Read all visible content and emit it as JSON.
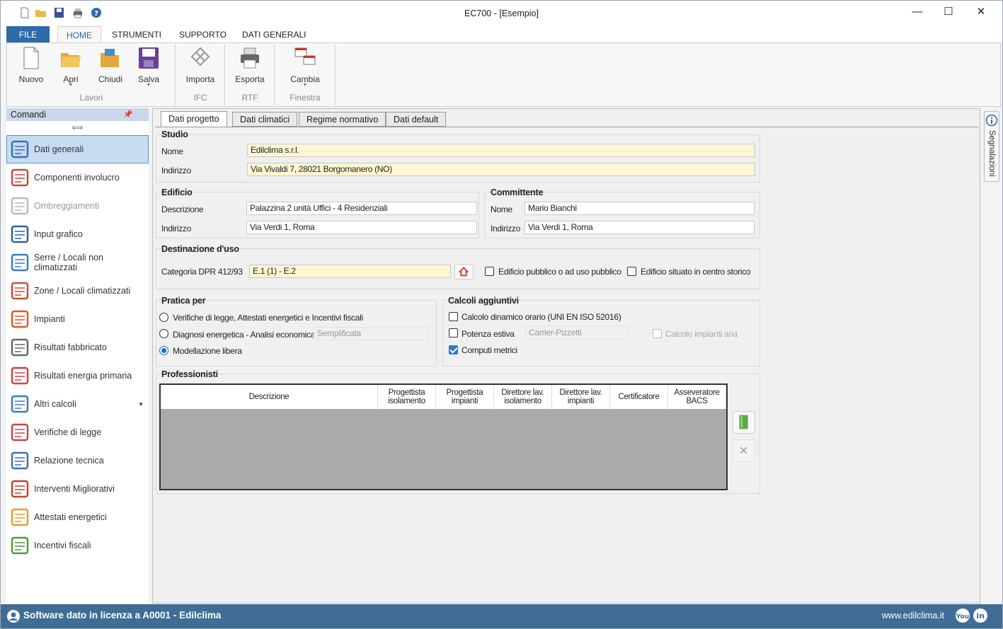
{
  "window": {
    "title": "EC700 - [Esempio]",
    "min": "—",
    "max": "☐",
    "close": "✕"
  },
  "ribbon_tabs": [
    "FILE",
    "HOME",
    "STRUMENTI",
    "SUPPORTO",
    "DATI GENERALI"
  ],
  "ribbon": {
    "buttons": [
      {
        "label": "Nuovo",
        "icon": "new-file-icon"
      },
      {
        "label": "Apri",
        "icon": "open-folder-icon"
      },
      {
        "label": "Chiudi",
        "icon": "close-folder-icon"
      },
      {
        "label": "Salva",
        "icon": "save-icon"
      },
      {
        "label": "Importa",
        "icon": "import-ifc-icon"
      },
      {
        "label": "Esporta",
        "icon": "printer-icon"
      },
      {
        "label": "Cambia",
        "icon": "window-switch-icon"
      }
    ],
    "groups": [
      "Lavori",
      "IFC",
      "RTF",
      "Finestra"
    ]
  },
  "commands": {
    "title": "Comandi",
    "items": [
      {
        "label": "Dati generali",
        "icon": "document-icon",
        "selected": true
      },
      {
        "label": "Componenti involucro",
        "icon": "components-icon"
      },
      {
        "label": "Ombreggiamenti",
        "icon": "shading-icon",
        "disabled": true
      },
      {
        "label": "Input grafico",
        "icon": "drawing-icon"
      },
      {
        "label": "Serre / Locali non climatizzati",
        "icon": "unheated-room-icon"
      },
      {
        "label": "Zone / Locali climatizzati",
        "icon": "heated-zone-icon"
      },
      {
        "label": "Impianti",
        "icon": "flame-icon"
      },
      {
        "label": "Risultati fabbricato",
        "icon": "results-table-icon"
      },
      {
        "label": "Risultati energia primaria",
        "icon": "energy-results-icon"
      },
      {
        "label": "Altri calcoli",
        "icon": "calculator-icon",
        "dropdown": true
      },
      {
        "label": "Verifiche di legge",
        "icon": "stamp-icon"
      },
      {
        "label": "Relazione tecnica",
        "icon": "report-icon"
      },
      {
        "label": "Interventi Migliorativi",
        "icon": "house-upgrade-icon"
      },
      {
        "label": "Attestati energetici",
        "icon": "energy-label-icon"
      },
      {
        "label": "Incentivi fiscali",
        "icon": "leaf-icon"
      }
    ]
  },
  "tabs": [
    "Dati progetto",
    "Dati climatici",
    "Regime normativo",
    "Dati default"
  ],
  "studio": {
    "title": "Studio",
    "nome_label": "Nome",
    "nome": "Edilclima s.r.l.",
    "indirizzo_label": "Indirizzo",
    "indirizzo": "Via Vivaldi 7, 28021 Borgomanero (NO)"
  },
  "edificio": {
    "title": "Edificio",
    "descrizione_label": "Descrizione",
    "descrizione": "Palazzina 2 unità Uffici - 4 Residenziali",
    "indirizzo_label": "Indirizzo",
    "indirizzo": "Via Verdi 1, Roma"
  },
  "committente": {
    "title": "Committente",
    "nome_label": "Nome",
    "nome": "Mario Bianchi",
    "indirizzo_label": "Indirizzo",
    "indirizzo": "Via Verdi 1, Roma"
  },
  "destinazione": {
    "title": "Destinazione d'uso",
    "categoria_label": "Categoria DPR 412/93",
    "categoria": "E.1 (1) - E.2",
    "pubblico": "Edificio pubblico o ad uso pubblico",
    "centro_storico": "Edificio situato in centro storico"
  },
  "pratica": {
    "title": "Pratica per",
    "options": [
      "Verifiche di legge, Attestati energetici e Incentivi fiscali",
      "Diagnosi energetica - Analisi economica",
      "Modellazione libera"
    ],
    "selected": 2,
    "diagnosi_mode": "Semplificata"
  },
  "calcoli": {
    "title": "Calcoli aggiuntivi",
    "dinamico": "Calcolo dinamico orario (UNI EN ISO 52016)",
    "estiva": "Potenza estiva",
    "estiva_method": "Carrier-Pizzetti",
    "impianti_aria": "Calcolo impianti aria",
    "computi": "Computi metrici",
    "computi_checked": true
  },
  "professionisti": {
    "title": "Professionisti",
    "columns": [
      "Descrizione",
      "Progettista isolamento",
      "Progettista impianti",
      "Direttore lav. isolamento",
      "Direttore lav. impianti",
      "Certificatore",
      "Asseveratore BACS"
    ]
  },
  "side_panel": {
    "label": "Segnalazioni"
  },
  "status": {
    "license": "Software dato in licenza a A0001 - Edilclima",
    "site": "www.edilclima.it"
  }
}
